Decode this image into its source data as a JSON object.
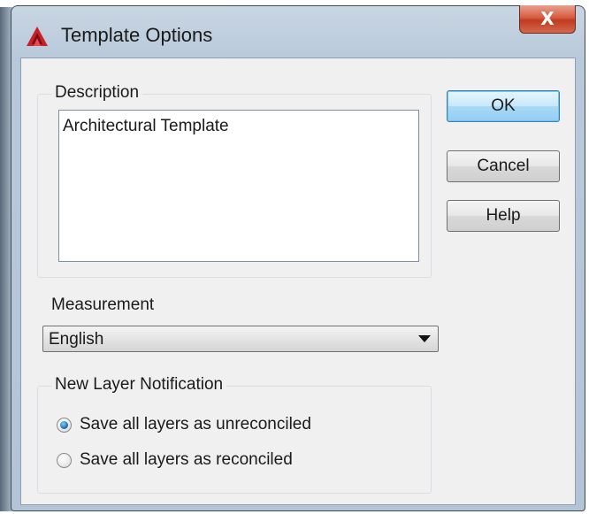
{
  "window": {
    "title": "Template Options",
    "close_glyph": "X"
  },
  "description": {
    "label": "Description",
    "value": "Architectural Template"
  },
  "buttons": {
    "ok": "OK",
    "cancel": "Cancel",
    "help": "Help"
  },
  "measurement": {
    "label": "Measurement",
    "selected": "English"
  },
  "layer_notification": {
    "label": "New Layer Notification",
    "options": [
      {
        "label": "Save all layers as unreconciled",
        "checked": true
      },
      {
        "label": "Save all layers as reconciled",
        "checked": false
      }
    ]
  },
  "icons": {
    "app": "autocad-app-icon",
    "close": "close-icon",
    "dropdown": "chevron-down-icon"
  },
  "colors": {
    "ok_accent": "#3c7fb1",
    "close_red": "#c03a20",
    "app_icon_red": "#c8202a"
  }
}
